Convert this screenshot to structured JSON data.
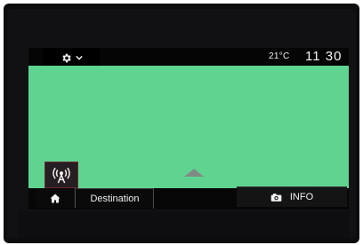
{
  "status": {
    "temperature": "21°C",
    "time": "11 30"
  },
  "icons": {
    "settings": "gear-icon",
    "dropdown": "chevron-down-icon",
    "radio": "radio-broadcast-icon",
    "home": "home-icon",
    "info": "camera-info-icon",
    "compass": "navigation-arrow-icon"
  },
  "nav": {
    "destination_label": "Destination",
    "info_label": "INFO"
  },
  "colors": {
    "map_background": "#5fd491",
    "radio_accent": "#6b2732"
  }
}
